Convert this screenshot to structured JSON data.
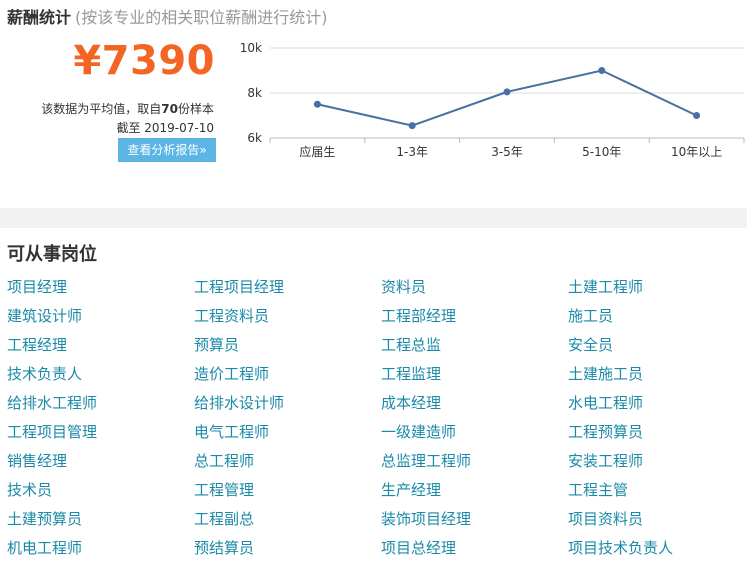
{
  "header": {
    "title": "薪酬统计",
    "subtitle": "(按该专业的相关职位薪酬进行统计)"
  },
  "salary": {
    "amount": "¥7390",
    "note_prefix": "该数据为平均值，取自",
    "sample_count": "70",
    "note_suffix": "份样本",
    "date_label": "截至 2019-07-10",
    "report_button": "查看分析报告»"
  },
  "chart_data": {
    "type": "line",
    "categories": [
      "应届生",
      "1-3年",
      "3-5年",
      "5-10年",
      "10年以上"
    ],
    "values": [
      7500,
      6550,
      8050,
      9000,
      7000
    ],
    "ylim": [
      6000,
      10000
    ],
    "yticks": [
      6000,
      8000,
      10000
    ],
    "ytick_labels": [
      "6k",
      "8k",
      "10k"
    ],
    "grid": true,
    "line_color": "#4a6fa5"
  },
  "jobs": {
    "title": "可从事岗位",
    "items": [
      "项目经理",
      "工程项目经理",
      "资料员",
      "土建工程师",
      "建筑设计师",
      "工程资料员",
      "工程部经理",
      "施工员",
      "工程经理",
      "预算员",
      "工程总监",
      "安全员",
      "技术负责人",
      "造价工程师",
      "工程监理",
      "土建施工员",
      "给排水工程师",
      "给排水设计师",
      "成本经理",
      "水电工程师",
      "工程项目管理",
      "电气工程师",
      "一级建造师",
      "工程预算员",
      "销售经理",
      "总工程师",
      "总监理工程师",
      "安装工程师",
      "技术员",
      "工程管理",
      "生产经理",
      "工程主管",
      "土建预算员",
      "工程副总",
      "装饰项目经理",
      "项目资料员",
      "机电工程师",
      "预结算员",
      "项目总经理",
      "项目技术负责人"
    ]
  }
}
